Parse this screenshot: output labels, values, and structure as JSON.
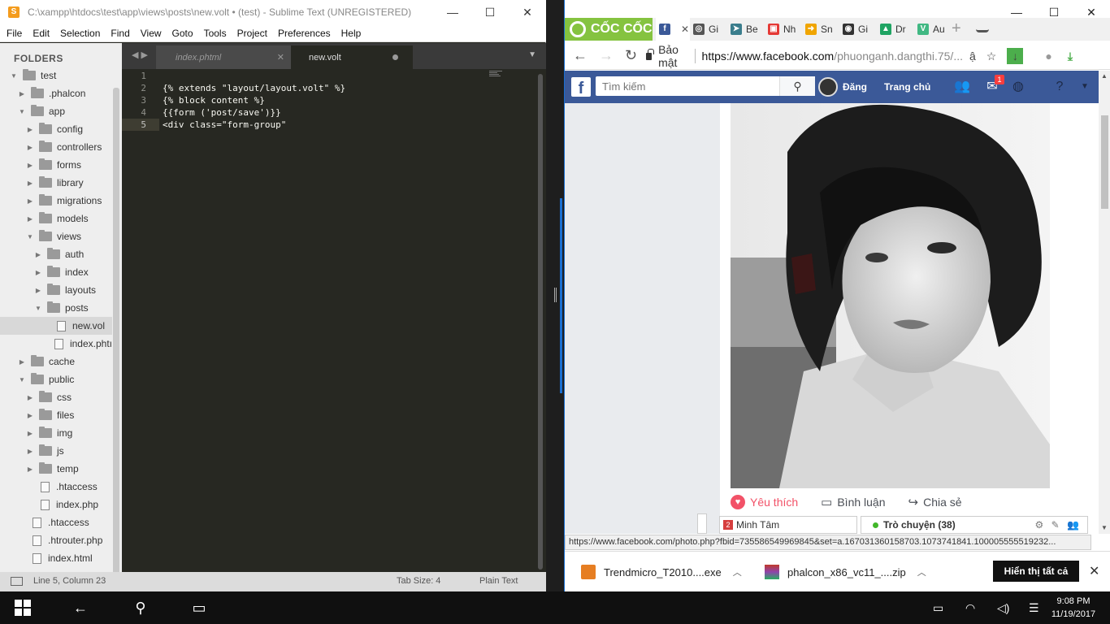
{
  "sublime": {
    "title": "C:\\xampp\\htdocs\\test\\app\\views\\posts\\new.volt • (test) - Sublime Text (UNREGISTERED)",
    "menu": [
      "File",
      "Edit",
      "Selection",
      "Find",
      "View",
      "Goto",
      "Tools",
      "Project",
      "Preferences",
      "Help"
    ],
    "sidebar_header": "FOLDERS",
    "tree": [
      {
        "label": "test",
        "type": "folder",
        "open": true,
        "depth": 0
      },
      {
        "label": ".phalcon",
        "type": "folder",
        "open": false,
        "depth": 1
      },
      {
        "label": "app",
        "type": "folder",
        "open": true,
        "depth": 1
      },
      {
        "label": "config",
        "type": "folder",
        "open": false,
        "depth": 2
      },
      {
        "label": "controllers",
        "type": "folder",
        "open": false,
        "depth": 2
      },
      {
        "label": "forms",
        "type": "folder",
        "open": false,
        "depth": 2
      },
      {
        "label": "library",
        "type": "folder",
        "open": false,
        "depth": 2
      },
      {
        "label": "migrations",
        "type": "folder",
        "open": false,
        "depth": 2
      },
      {
        "label": "models",
        "type": "folder",
        "open": false,
        "depth": 2
      },
      {
        "label": "views",
        "type": "folder",
        "open": true,
        "depth": 2
      },
      {
        "label": "auth",
        "type": "folder",
        "open": false,
        "depth": 3
      },
      {
        "label": "index",
        "type": "folder",
        "open": false,
        "depth": 3
      },
      {
        "label": "layouts",
        "type": "folder",
        "open": false,
        "depth": 3
      },
      {
        "label": "posts",
        "type": "folder",
        "open": true,
        "depth": 3
      },
      {
        "label": "new.vol",
        "type": "file",
        "depth": 4,
        "selected": true
      },
      {
        "label": "index.phtı",
        "type": "file",
        "depth": 4
      },
      {
        "label": "cache",
        "type": "folder",
        "open": false,
        "depth": 1
      },
      {
        "label": "public",
        "type": "folder",
        "open": true,
        "depth": 1
      },
      {
        "label": "css",
        "type": "folder",
        "open": false,
        "depth": 2
      },
      {
        "label": "files",
        "type": "folder",
        "open": false,
        "depth": 2
      },
      {
        "label": "img",
        "type": "folder",
        "open": false,
        "depth": 2
      },
      {
        "label": "js",
        "type": "folder",
        "open": false,
        "depth": 2
      },
      {
        "label": "temp",
        "type": "folder",
        "open": false,
        "depth": 2
      },
      {
        "label": ".htaccess",
        "type": "file",
        "depth": 2
      },
      {
        "label": "index.php",
        "type": "file",
        "depth": 2
      },
      {
        "label": ".htaccess",
        "type": "file",
        "depth": 1
      },
      {
        "label": ".htrouter.php",
        "type": "file",
        "depth": 1
      },
      {
        "label": "index.html",
        "type": "file",
        "depth": 1
      }
    ],
    "tabs": [
      {
        "label": "index.phtml",
        "active": false
      },
      {
        "label": "new.volt",
        "active": true,
        "dirty": true
      }
    ],
    "code": [
      "",
      "{% extends \"layout/layout.volt\" %}",
      "{% block content %}",
      "{{form ('post/save')}}",
      "<div class=\"form-group\""
    ],
    "current_line": 5,
    "status": {
      "position": "Line 5, Column 23",
      "tab_size": "Tab Size: 4",
      "syntax": "Plain Text"
    }
  },
  "browser": {
    "brand": "CỐC CỐC",
    "tabs": [
      {
        "label": "",
        "icon": "facebook-icon",
        "color": "#3b5998",
        "glyph": "f",
        "active": true
      },
      {
        "label": "Gi",
        "icon": "github-icon",
        "color": "#555555",
        "glyph": "◎"
      },
      {
        "label": "Be",
        "icon": "arrow-icon",
        "color": "#3a7d8c",
        "glyph": "➤"
      },
      {
        "label": "Nh",
        "icon": "news-icon",
        "color": "#e53935",
        "glyph": "▣"
      },
      {
        "label": "Sn",
        "icon": "forward-icon",
        "color": "#f0a500",
        "glyph": "➜"
      },
      {
        "label": "Gi",
        "icon": "github-icon",
        "color": "#333333",
        "glyph": "◉"
      },
      {
        "label": "Dr",
        "icon": "drive-icon",
        "color": "#1fa463",
        "glyph": "▲"
      },
      {
        "label": "Au",
        "icon": "vuejs-icon",
        "color": "#41b883",
        "glyph": "V"
      }
    ],
    "url_security": "Bảo mật",
    "url_host": "https://www.facebook.com",
    "url_path": "/phuonganh.dangthi.75/...",
    "facebook": {
      "search_placeholder": "Tìm kiếm",
      "user_name": "Đăng",
      "home": "Trang chủ",
      "messages_badge": "1",
      "actions": {
        "like": "Yêu thích",
        "comment": "Bình luận",
        "share": "Chia sẻ"
      },
      "chat_person_badge": "2",
      "chat_person": "Minh Tâm",
      "chat_label": "Trò chuyện (38)"
    },
    "status_url": "https://www.facebook.com/photo.php?fbid=735586549969845&set=a.167031360158703.1073741841.100005555519232...",
    "downloads": [
      {
        "label": "Trendmicro_T2010....exe"
      },
      {
        "label": "phalcon_x86_vc11_....zip"
      }
    ],
    "show_all": "Hiển thị tất cả"
  },
  "taskbar": {
    "time": "9:08 PM",
    "date": "11/19/2017"
  },
  "colors": {
    "editor_bg": "#272822",
    "facebook_blue": "#3b5998",
    "coccoc_green": "#85c340",
    "taskbar": "#101010"
  }
}
